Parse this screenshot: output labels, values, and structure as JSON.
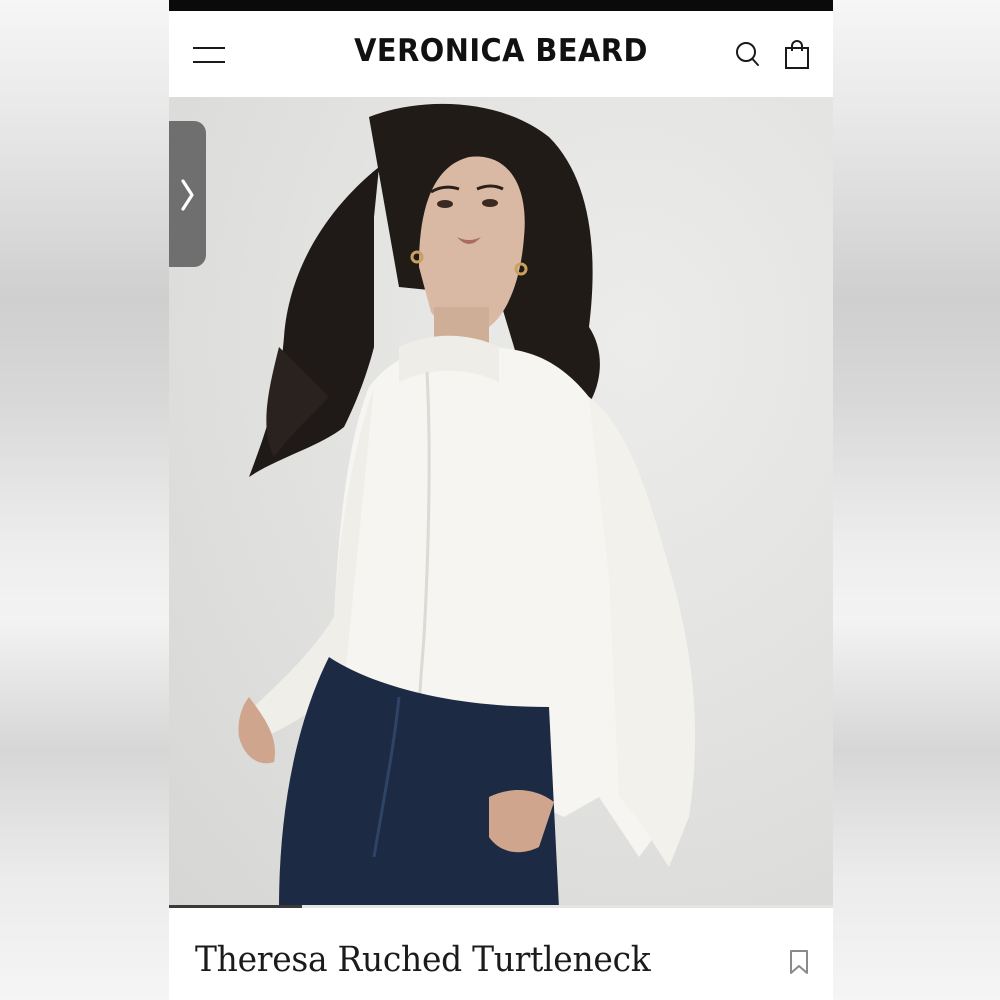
{
  "header": {
    "brand": "VERONICA BEARD",
    "menu_icon": "hamburger-menu-icon",
    "search_icon": "search-icon",
    "bag_icon": "shopping-bag-icon"
  },
  "hero": {
    "image_description": "",
    "next_icon": "chevron-right-icon",
    "progress": 0.2
  },
  "product": {
    "title": "Theresa Ruched Turtleneck",
    "save_icon": "bookmark-icon"
  },
  "colors": {
    "background": "#ffffff",
    "text": "#111111",
    "carousel_button": "#6f6f6f"
  }
}
